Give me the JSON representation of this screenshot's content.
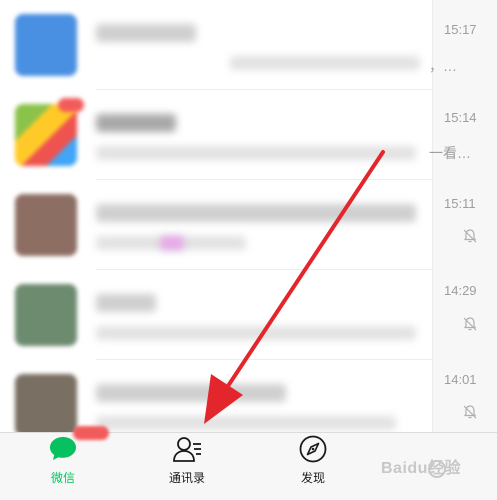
{
  "chats": [
    {
      "time": "15:17",
      "snippet": "，…",
      "muted": false,
      "avatar_color": "#4a90e2"
    },
    {
      "time": "15:14",
      "snippet": "一看…",
      "muted": false,
      "avatar_color": "#8bc34a"
    },
    {
      "time": "15:11",
      "snippet": "",
      "muted": true,
      "avatar_color": "#8d6e63"
    },
    {
      "time": "14:29",
      "snippet": "",
      "muted": true,
      "avatar_color": "#6d8b6f"
    },
    {
      "time": "14:01",
      "snippet": "",
      "muted": true,
      "avatar_color": "#7a6f63"
    }
  ],
  "tabbar": {
    "tabs": [
      {
        "label": "微信",
        "icon": "chat-bubble-icon",
        "active": true
      },
      {
        "label": "通讯录",
        "icon": "contacts-icon",
        "active": false
      },
      {
        "label": "发现",
        "icon": "compass-icon",
        "active": false
      }
    ]
  },
  "watermark": {
    "text": "Baidu经验"
  },
  "colors": {
    "accent": "#07c160",
    "badge": "#f25b5b",
    "annotation_arrow": "#e3262c"
  }
}
